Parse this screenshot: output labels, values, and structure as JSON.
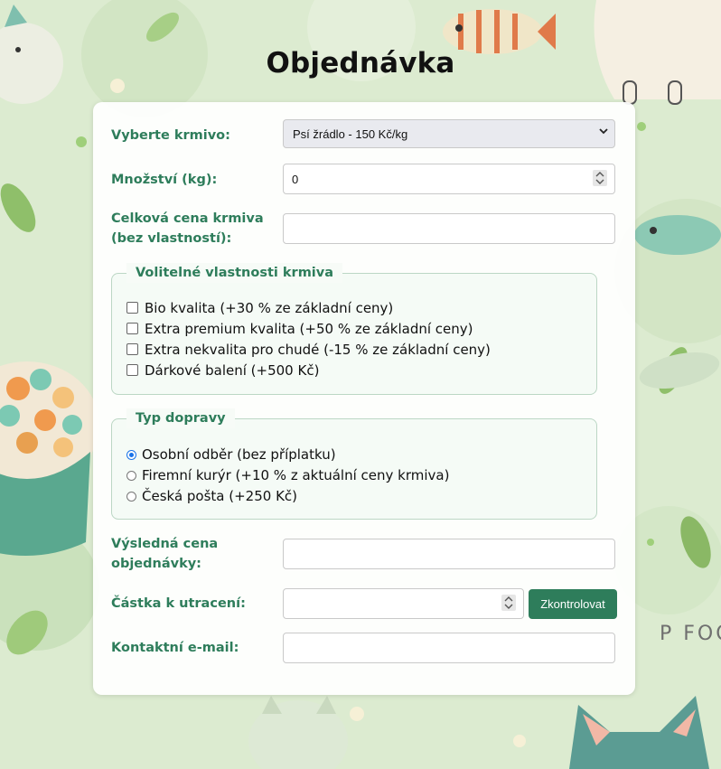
{
  "page": {
    "title": "Objednávka"
  },
  "form": {
    "food": {
      "label": "Vyberte krmivo:",
      "selected": "Psí žrádlo - 150 Kč/kg"
    },
    "amount": {
      "label": "Množství (kg):",
      "value": "0"
    },
    "base_price": {
      "label_line1": "Celková cena krmiva",
      "label_line2": "(bez vlastností):",
      "value": ""
    },
    "properties": {
      "legend": "Volitelné vlastnosti krmiva",
      "options": [
        {
          "label": "Bio kvalita (+30 % ze základní ceny)",
          "checked": false
        },
        {
          "label": "Extra premium kvalita (+50 % ze základní ceny)",
          "checked": false
        },
        {
          "label": "Extra nekvalita pro chudé (-15 % ze základní ceny)",
          "checked": false
        },
        {
          "label": "Dárkové balení (+500 Kč)",
          "checked": false
        }
      ]
    },
    "delivery": {
      "legend": "Typ dopravy",
      "options": [
        {
          "label": "Osobní odběr (bez příplatku)",
          "selected": true
        },
        {
          "label": "Firemní kurýr (+10 % z aktuální ceny krmiva)",
          "selected": false
        },
        {
          "label": "Česká pošta (+250 Kč)",
          "selected": false
        }
      ]
    },
    "final_price": {
      "label_line1": "Výsledná cena",
      "label_line2": "objednávky:",
      "value": ""
    },
    "budget": {
      "label": "Částka k utracení:",
      "value": "",
      "button": "Zkontrolovat"
    },
    "email": {
      "label": "Kontaktní e-mail:",
      "value": ""
    }
  },
  "background": {
    "text": "P FOOD"
  },
  "colors": {
    "accent": "#2e7d5b",
    "radio_selected": "#1a73e8",
    "background": "#dcebd0"
  }
}
